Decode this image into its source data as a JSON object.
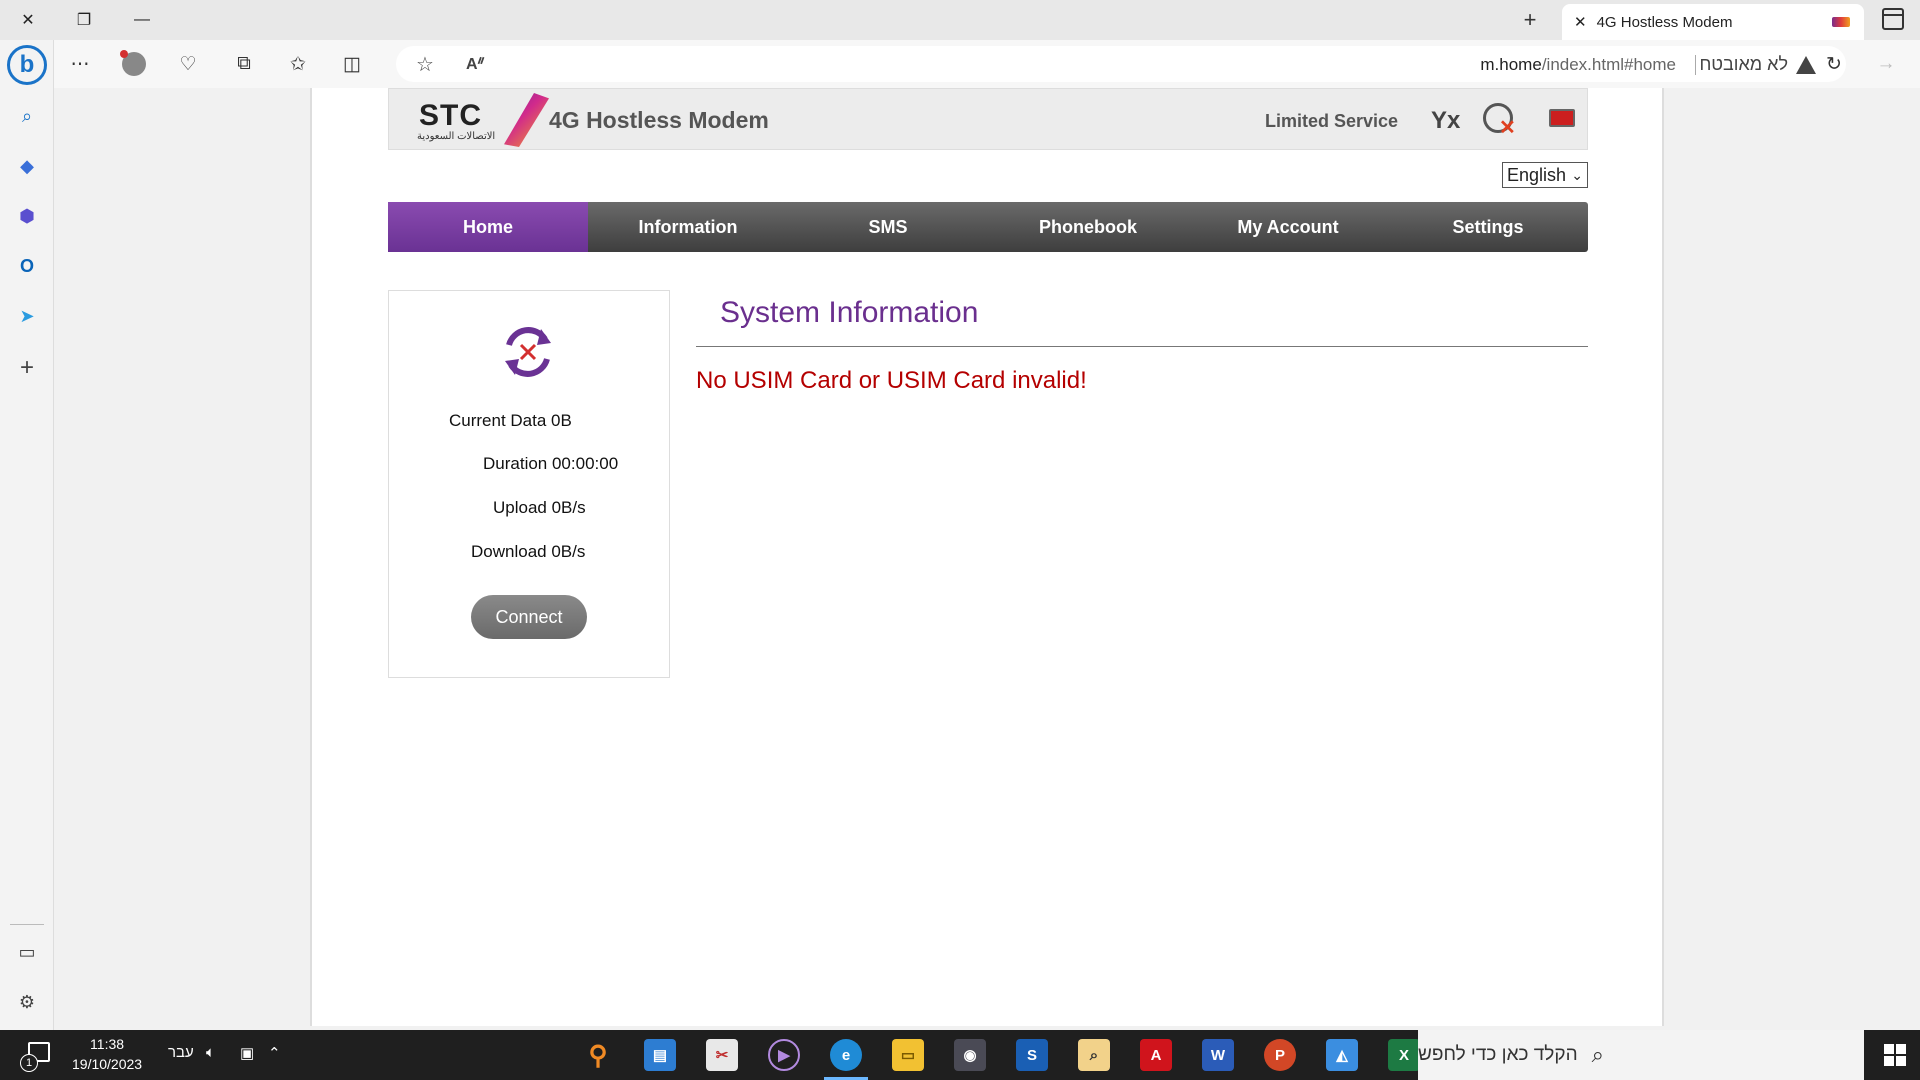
{
  "browser": {
    "tab_title": "4G Hostless Modem",
    "url_host": "m.home",
    "url_path": "/index.html#home",
    "security_label": "לא מאובטח"
  },
  "modem": {
    "brand_ar": "الاتصالات السعودية",
    "brand": "STC",
    "title": "4G Hostless Modem",
    "service_status": "Limited Service",
    "signal_glyph": "Yx",
    "language": "English",
    "language_chevron": "⌄",
    "nav": [
      "Home",
      "Information",
      "SMS",
      "Phonebook",
      "My Account",
      "Settings"
    ],
    "active_nav": "Home",
    "stats": {
      "current_data": "Current Data 0B",
      "duration": "Duration 00:00:00",
      "upload": "Upload 0B/s",
      "download": "Download 0B/s"
    },
    "connect_label": "Connect",
    "sys_title": "System Information",
    "sys_error": "No USIM Card or USIM Card invalid!"
  },
  "taskbar": {
    "time": "11:38",
    "date": "19/10/2023",
    "lang": "עבר",
    "search_placeholder": "הקלד כאן כדי לחפש",
    "notification_count": "1"
  },
  "colors": {
    "accent_purple": "#6a3294",
    "error_red": "#b40000",
    "nav_gray": "#4a4a4a"
  }
}
